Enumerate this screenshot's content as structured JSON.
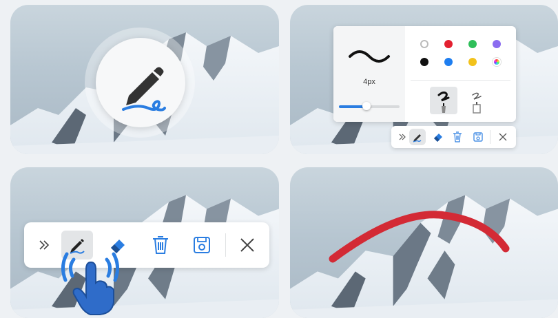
{
  "panels": {
    "intro": {
      "icon": "pen-signature-icon"
    },
    "settings": {
      "stroke_size_label": "4px",
      "stroke_slider_value": 0.45,
      "colors": [
        "#ffffff",
        "#e32030",
        "#2fbf5a",
        "#8b6cf0",
        "#111111",
        "#1e7ef0",
        "#f2c21c",
        "rainbow"
      ],
      "pen_types": [
        "calligraphy-pen-icon",
        "ink-pen-icon"
      ],
      "active_pen_type": "calligraphy-pen-icon"
    },
    "toolbar": {
      "tools": [
        "collapse-icon",
        "pen-icon",
        "eraser-icon",
        "trash-icon",
        "save-icon",
        "close-icon"
      ],
      "active_tool": "pen-icon"
    },
    "drawing": {
      "stroke_color": "#d32a35"
    }
  },
  "colors": {
    "accent_blue": "#2a7de1",
    "pen_ink": "#333333",
    "background": "#eef1f4"
  }
}
